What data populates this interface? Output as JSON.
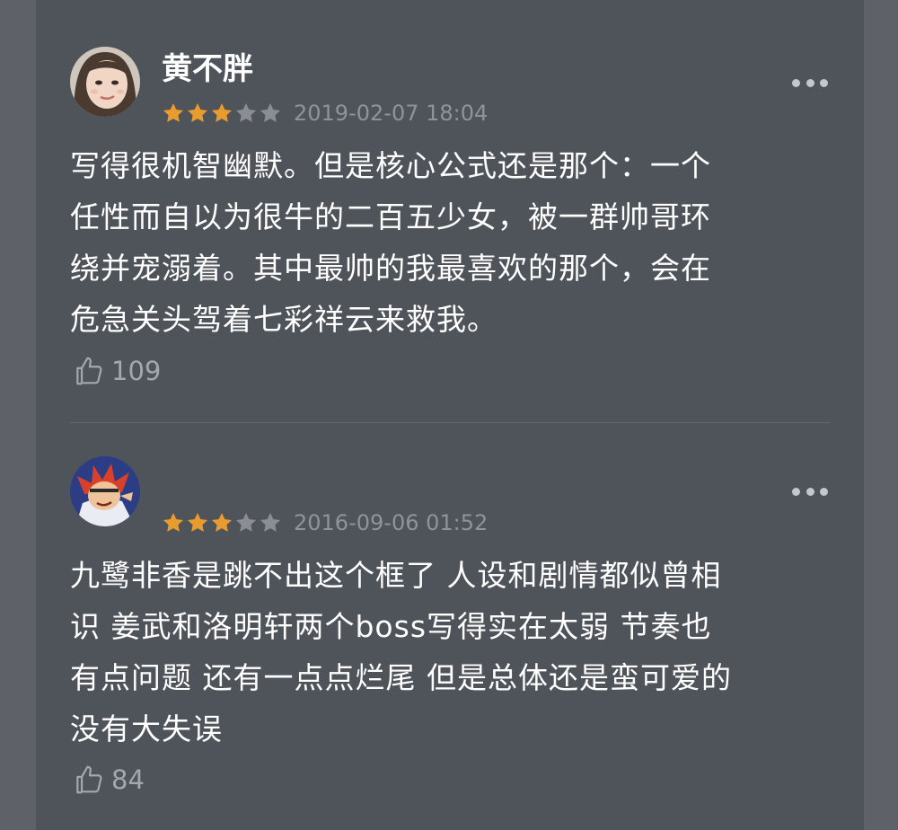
{
  "colors": {
    "background": "#5e6268",
    "card": "#4f545a",
    "star_filled": "#e89c30",
    "star_empty": "#8a8e93",
    "text_primary": "#ffffff",
    "text_secondary": "#8f949a"
  },
  "reviews": [
    {
      "username": "黄不胖",
      "rating": 3,
      "max_rating": 5,
      "timestamp": "2019-02-07 18:04",
      "lines": [
        "写得很机智幽默。但是核心公式还是那个：一个",
        "任性而自以为很牛的二百五少女，被一群帅哥环",
        "绕并宠溺着。其中最帅的我最喜欢的那个，会在",
        "危急关头驾着七彩祥云来救我。"
      ],
      "likes": "109",
      "avatar_icon": "girl-avatar-icon",
      "more_icon": "more-dots-icon",
      "like_icon": "thumbs-up-icon"
    },
    {
      "username": "",
      "rating": 3,
      "max_rating": 5,
      "timestamp": "2016-09-06 01:52",
      "lines": [
        "九鹭非香是跳不出这个框了 人设和剧情都似曾相",
        "识 姜武和洛明轩两个boss写得实在太弱 节奏也",
        "有点问题 还有一点点烂尾 但是总体还是蛮可爱的",
        "没有大失误"
      ],
      "likes": "84",
      "avatar_icon": "cartoon-avatar-icon",
      "more_icon": "more-dots-icon",
      "like_icon": "thumbs-up-icon"
    }
  ]
}
